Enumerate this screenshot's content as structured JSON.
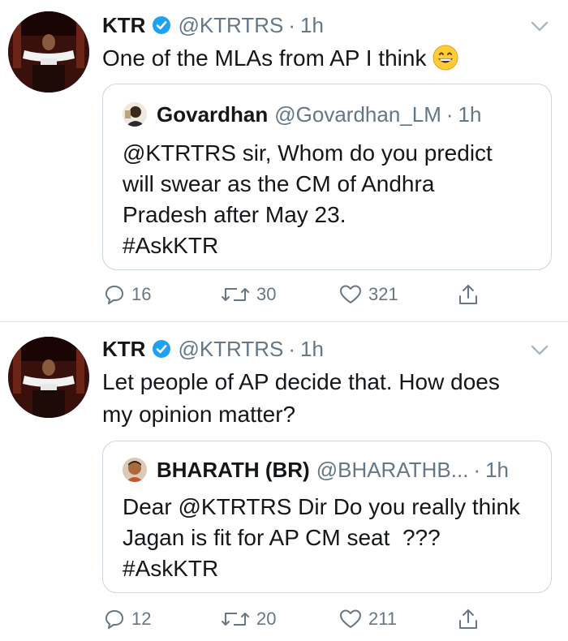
{
  "tweets": [
    {
      "author_name": "KTR",
      "author_handle": "@KTRTRS",
      "time": "1h",
      "separator": "·",
      "text": "One of the MLAs from AP I think",
      "quoted": {
        "author_name": "Govardhan",
        "author_handle": "@Govardhan_LM",
        "time": "1h",
        "text_lines": [
          "@KTRTRS sir, Whom do you predict",
          "will swear as the CM of Andhra",
          "Pradesh after May 23.",
          "#AskKTR"
        ]
      },
      "stats": {
        "replies": "16",
        "retweets": "30",
        "likes": "321"
      }
    },
    {
      "author_name": "KTR",
      "author_handle": "@KTRTRS",
      "time": "1h",
      "separator": "·",
      "text_lines": [
        "Let people of AP decide that. How does",
        "my opinion matter?"
      ],
      "quoted": {
        "author_name": "BHARATH (BR)",
        "author_handle": "@BHARATHB...",
        "time": "1h",
        "text_lines": [
          "Dear @KTRTRS Dir Do you really think",
          "Jagan is fit for AP CM seat  ???",
          "#AskKTR"
        ]
      },
      "stats": {
        "replies": "12",
        "retweets": "20",
        "likes": "211"
      }
    }
  ],
  "icons": {
    "verified": "verified-badge-icon",
    "more": "chevron-down-icon",
    "reply": "reply-icon",
    "retweet": "retweet-icon",
    "like": "heart-icon",
    "share": "share-icon",
    "emoji": "grinning-face-emoji"
  },
  "colors": {
    "verified": "#1da1f2",
    "secondary_text": "#657786",
    "border": "#ccd6dd"
  }
}
